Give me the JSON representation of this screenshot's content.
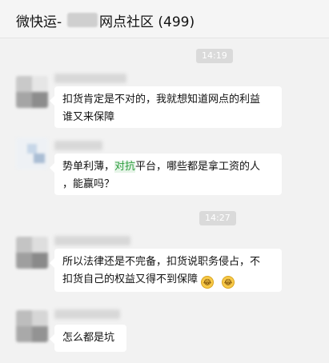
{
  "header": {
    "title_prefix": "微快运-",
    "title_suffix": "网点社区 (499)"
  },
  "timestamps": [
    "14:19",
    "14:27"
  ],
  "messages": [
    {
      "line1": "扣货肯定是不对的，我就想知道网点的利益",
      "line2": "谁又来保障"
    },
    {
      "line1_before": "势单利薄，",
      "line1_highlight": "对抗",
      "line1_after": "平台，哪些都是拿工资的人",
      "line2": "，能赢吗？"
    },
    {
      "line1": "所以法律还是不完备，扣货说职务侵占，不",
      "line2": "扣货自己的权益又得不到保障",
      "emoji_1": "😂",
      "emoji_2": "😂"
    },
    {
      "line1": "怎么都是坑"
    }
  ]
}
